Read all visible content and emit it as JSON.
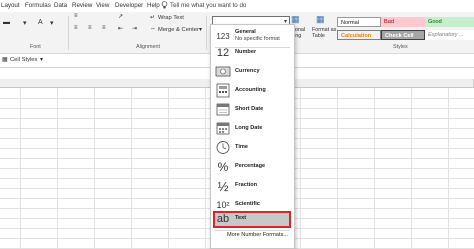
{
  "tabs": [
    "Layout",
    "Formulas",
    "Data",
    "Review",
    "View",
    "Developer",
    "Help"
  ],
  "tell_me": "Tell me what you want to do",
  "ribbon": {
    "wrap_text": "Wrap Text",
    "merge_center": "Merge & Center",
    "font_group": "Font",
    "alignment_group": "Alignment",
    "styles_group": "Styles",
    "conditional_formatting": "ditional\natting",
    "format_as_table": "Format as\nTable",
    "styles": {
      "normal": "Normal",
      "bad": "Bad",
      "good": "Good",
      "calculation": "Calculation",
      "check_cell": "Check Cell",
      "explanatory": "Explanatory ..."
    }
  },
  "cell_styles": "Cell Styles",
  "number_format_dropdown": {
    "items": [
      {
        "icon": "123",
        "label": "General",
        "sub": "No specific format"
      },
      {
        "icon": "12",
        "label": "Number",
        "sub": ""
      },
      {
        "icon": "currency-icon",
        "label": "Currency",
        "sub": ""
      },
      {
        "icon": "accounting-icon",
        "label": "Accounting",
        "sub": ""
      },
      {
        "icon": "short-date-icon",
        "label": "Short Date",
        "sub": ""
      },
      {
        "icon": "long-date-icon",
        "label": "Long Date",
        "sub": ""
      },
      {
        "icon": "clock-icon",
        "label": "Time",
        "sub": ""
      },
      {
        "icon": "%",
        "label": "Percentage",
        "sub": ""
      },
      {
        "icon": "½",
        "label": "Fraction",
        "sub": ""
      },
      {
        "icon": "10²",
        "label": "Scientific",
        "sub": ""
      },
      {
        "icon": "ab",
        "label": "Text",
        "sub": ""
      }
    ],
    "more": "More Number Formats..."
  },
  "colors": {
    "highlight_border": "#d9262b",
    "bad_bg": "#ffc7ce",
    "good_bg": "#c6efce",
    "calculation_bg": "#f2f2f2",
    "check_cell_bg": "#a5a5a5"
  }
}
